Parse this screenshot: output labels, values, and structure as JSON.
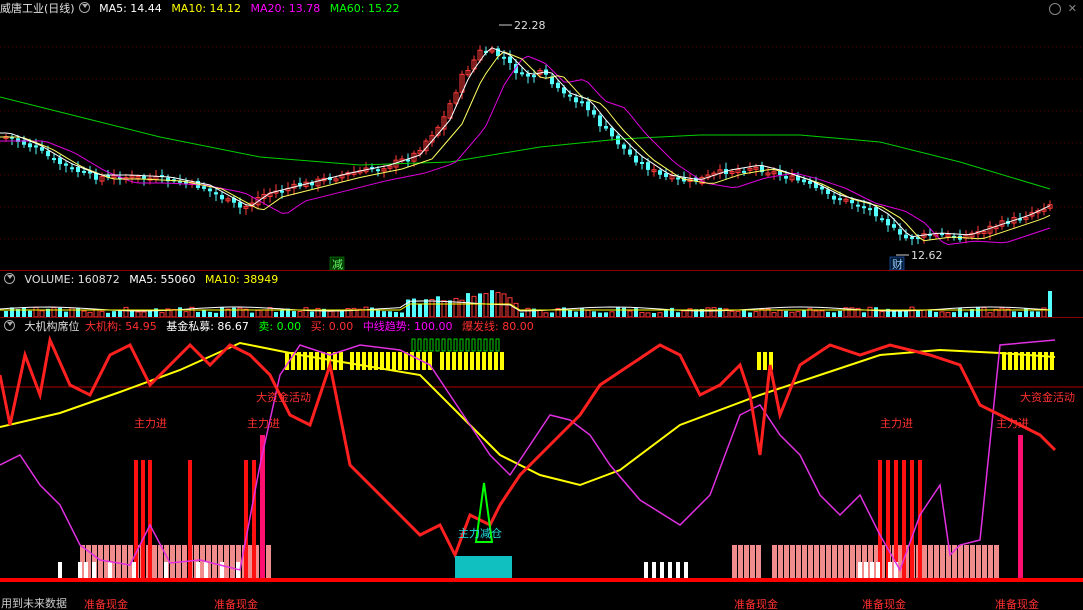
{
  "main_header": {
    "title": "威唐工业(日线)",
    "ma5": "MA5: 14.44",
    "ma10": "MA10: 14.12",
    "ma20": "MA20: 13.78",
    "ma60": "MA60: 15.22"
  },
  "price_labels": {
    "high": "22.28",
    "low": "12.62"
  },
  "markers": {
    "jian": "减",
    "cai": "财"
  },
  "volume_header": {
    "label": "VOLUME: 160872",
    "ma5": "MA5: 55060",
    "ma10": "MA10: 38949"
  },
  "indicator_header": {
    "name": "大机构席位",
    "dajigou": "大机构: 54.95",
    "jijin": "基金私募: 86.67",
    "mai_sell": "卖: 0.00",
    "mai_buy": "买: 0.00",
    "zhongxian": "中线趋势: 100.00",
    "baofa": "爆发线: 80.00"
  },
  "annotations": {
    "zhulijin": "主力进",
    "dazijin": "大资金活动",
    "zhulijiancang": "主力减仓",
    "zhunbei": "准备现金",
    "future": "用到未来数据"
  },
  "colors": {
    "bg": "#000000",
    "up": "#ff3a3a",
    "down": "#54ffff",
    "ma5": "#ffffff",
    "ma10": "#ffff00",
    "ma20": "#ff00ff",
    "ma60": "#00ff00"
  }
}
